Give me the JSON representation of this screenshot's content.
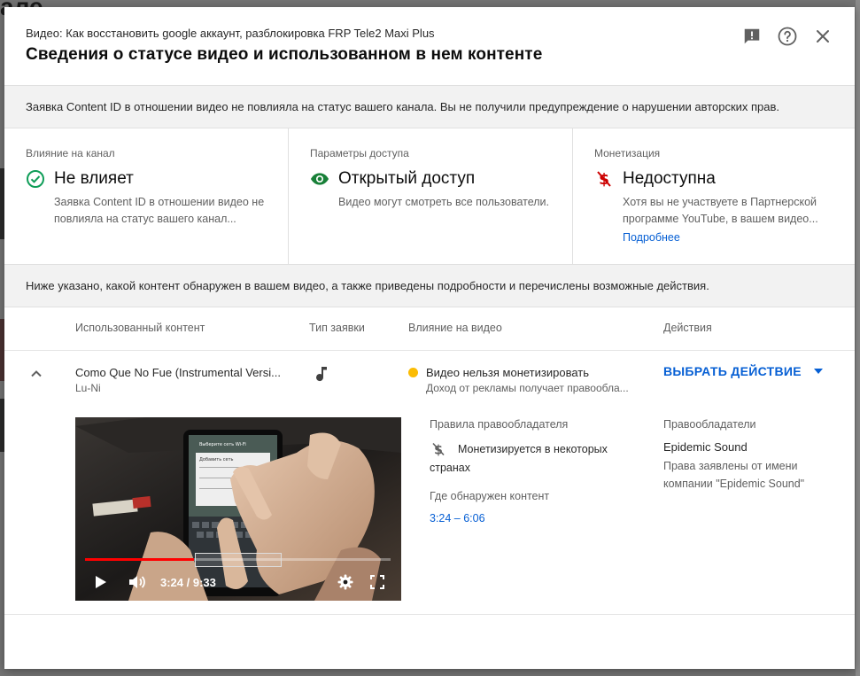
{
  "background": {
    "partial_title": "але"
  },
  "header": {
    "video_line": "Видео: Как восстановить google аккаунт, разблокировка FRP Tele2 Maxi Plus",
    "title": "Сведения о статусе видео и использованном в нем контенте",
    "icons": [
      "feedback-icon",
      "help-icon",
      "close-icon"
    ]
  },
  "banner_top": "Заявка Content ID в отношении видео не повлияла на статус вашего канала. Вы не получили предупреждение о нарушении авторских прав.",
  "cards": [
    {
      "label": "Влияние на канал",
      "value": "Не влияет",
      "icon": "check-circle-icon",
      "icon_color": "#0f9d58",
      "desc": "Заявка Content ID в отношении видео не повлияла на статус вашего канал..."
    },
    {
      "label": "Параметры доступа",
      "value": "Открытый доступ",
      "icon": "eye-icon",
      "icon_color": "#188038",
      "desc": "Видео могут смотреть все пользователи."
    },
    {
      "label": "Монетизация",
      "value": "Недоступна",
      "icon": "dollar-off-icon",
      "icon_color": "#c00",
      "desc": "Хотя вы не участвуете в Партнерской программе YouTube, в вашем видео...",
      "link": "Подробнее"
    }
  ],
  "banner_bottom": "Ниже указано, какой контент обнаружен в вашем видео, а также приведены подробности и перечислены возможные действия.",
  "table": {
    "headers": [
      "Использованный контент",
      "Тип заявки",
      "Влияние на видео",
      "Действия"
    ],
    "row": {
      "title": "Como Que No Fue (Instrumental Versi...",
      "artist": "Lu-Ni",
      "claim_type_icon": "music-note-icon",
      "impact_title": "Видео нельзя монетизировать",
      "impact_desc": "Доход от рекламы получает правообла...",
      "impact_color": "#fbbc04",
      "action": "ВЫБРАТЬ ДЕЙСТВИЕ"
    }
  },
  "details": {
    "policy_label": "Правила правообладателя",
    "policy_text": "Монетизируется в некоторых странах",
    "found_label": "Где обнаружен контент",
    "found_range": "3:24 – 6:06",
    "owners_label": "Правообладатели",
    "owner_name": "Epidemic Sound",
    "owner_desc": "Права заявлены от имени компании \"Epidemic Sound\""
  },
  "player": {
    "time": "3:24 / 9:33",
    "progress": 0.357,
    "screen_lines": [
      "Выберите сеть Wi-Fi",
      "Добавить сеть"
    ]
  },
  "colors": {
    "accent": "#065fd4",
    "progress": "#ff0000"
  }
}
